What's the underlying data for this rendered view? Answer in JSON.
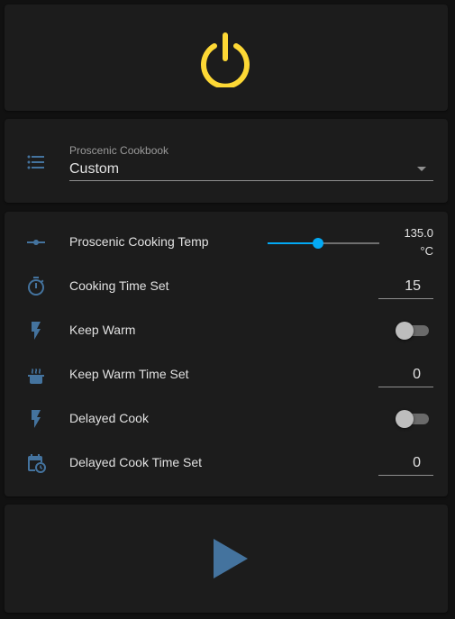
{
  "colors": {
    "power_icon": "#fdd835",
    "entity_icon": "#44739e",
    "slider_accent": "#03a9f4",
    "card_background": "#1c1c1c",
    "page_background": "#111111"
  },
  "power": {
    "icon": "power-icon"
  },
  "cookbook": {
    "icon": "format-list-bulleted-icon",
    "label": "Proscenic Cookbook",
    "value": "Custom"
  },
  "entities": [
    {
      "icon": "ray-vertex-icon",
      "label": "Proscenic Cooking Temp",
      "control": "slider",
      "value": 135.0,
      "display_value": "135.0",
      "unit": "°C",
      "level": 0.45
    },
    {
      "icon": "timer-outline-icon",
      "label": "Cooking Time Set",
      "control": "number",
      "value": "15"
    },
    {
      "icon": "flash-icon",
      "label": "Keep Warm",
      "control": "toggle",
      "state": "off"
    },
    {
      "icon": "pot-steam-icon",
      "label": "Keep Warm Time Set",
      "control": "number",
      "value": "0"
    },
    {
      "icon": "flash-icon",
      "label": "Delayed Cook",
      "control": "toggle",
      "state": "off"
    },
    {
      "icon": "calendar-clock-icon",
      "label": "Delayed Cook Time Set",
      "control": "number",
      "value": "0"
    }
  ],
  "play": {
    "icon": "play-icon"
  }
}
